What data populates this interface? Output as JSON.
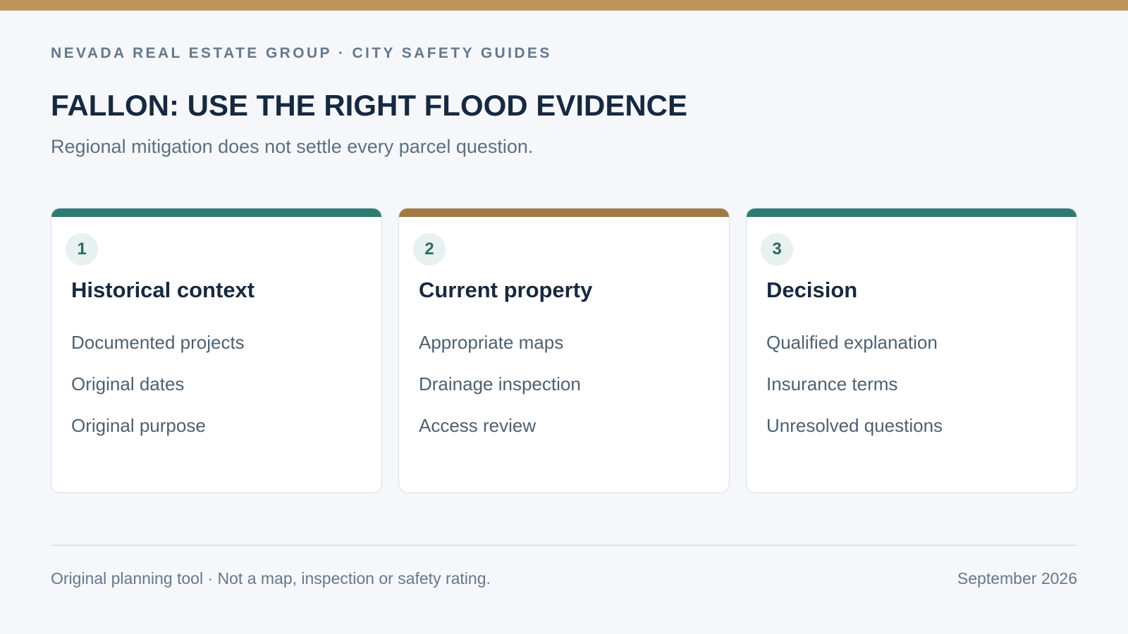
{
  "colors": {
    "top_bar": "#bf965a",
    "accent_teal": "#2f7b73",
    "accent_gold": "#a07a43",
    "badge_background": "#e7f1ef",
    "badge_text": "#2d6b62"
  },
  "header": {
    "eyebrow": "NEVADA REAL ESTATE GROUP · CITY SAFETY GUIDES",
    "title": "FALLON: USE THE RIGHT FLOOD EVIDENCE",
    "subtitle": "Regional mitigation does not settle every parcel question."
  },
  "cards": [
    {
      "number": "1",
      "title": "Historical context",
      "accent": "#2f7b73",
      "items": [
        "Documented projects",
        "Original dates",
        "Original purpose"
      ]
    },
    {
      "number": "2",
      "title": "Current property",
      "accent": "#a07a43",
      "items": [
        "Appropriate maps",
        "Drainage inspection",
        "Access review"
      ]
    },
    {
      "number": "3",
      "title": "Decision",
      "accent": "#2f7b73",
      "items": [
        "Qualified explanation",
        "Insurance terms",
        "Unresolved questions"
      ]
    }
  ],
  "footer": {
    "note": "Original planning tool · Not a map, inspection or safety rating.",
    "date": "September 2026"
  }
}
